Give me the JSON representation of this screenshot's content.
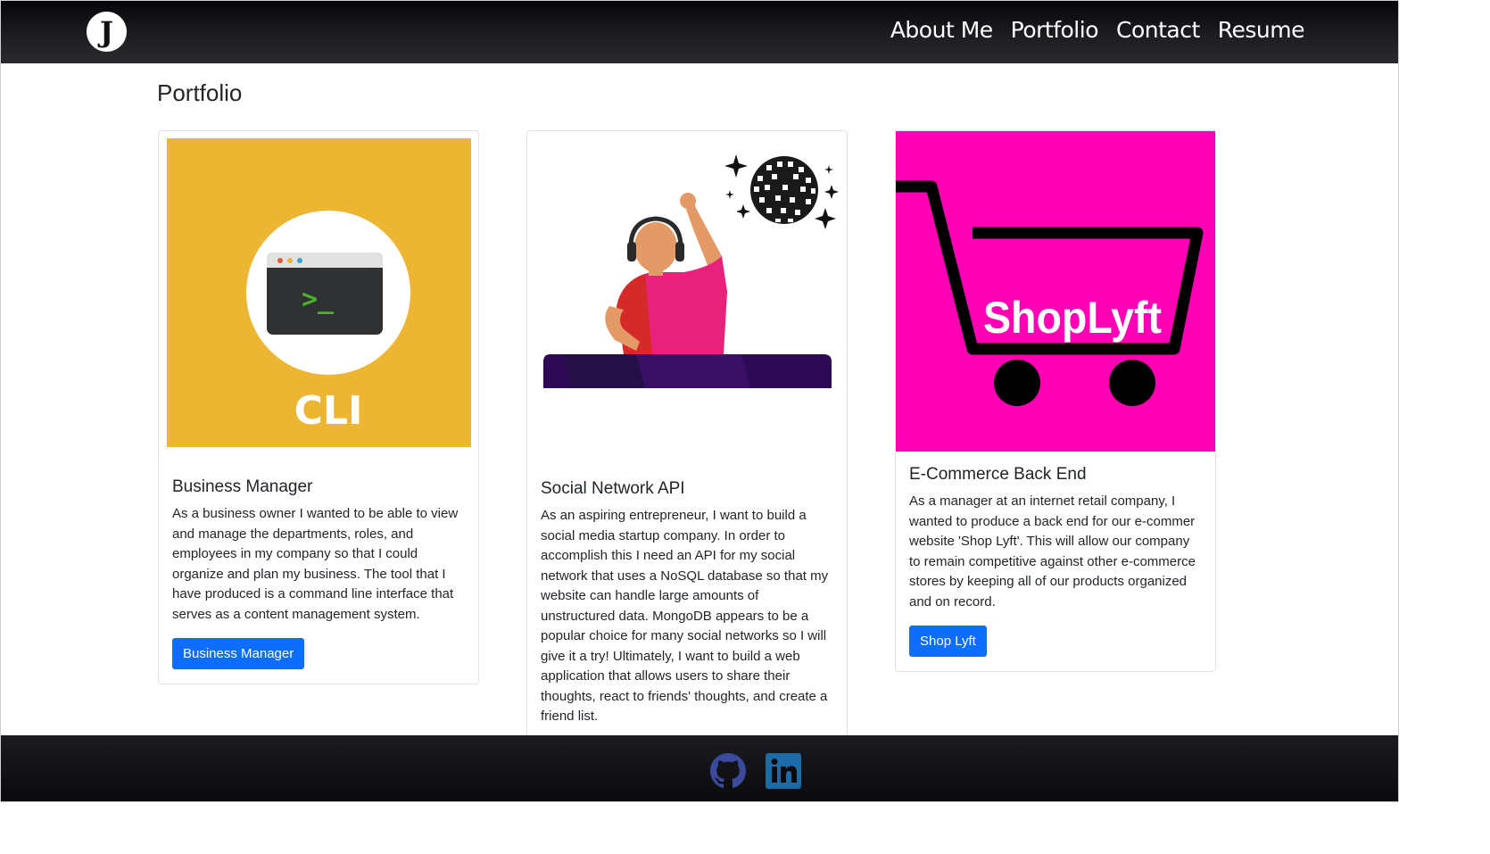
{
  "header": {
    "logo_icon": "j-monogram-logo",
    "nav": [
      "About Me",
      "Portfolio",
      "Contact",
      "Resume"
    ]
  },
  "main": {
    "page_title": "Portfolio",
    "cards": [
      {
        "title": "Business Manager",
        "image_label": "CLI",
        "text": "As a business owner I wanted to be able to view and manage the departments, roles, and employees in my company so that I could organize and plan my business. The tool that I have produced is a command line interface that serves as a content management system.",
        "button": "Business Manager"
      },
      {
        "title": "Social Network API",
        "image_label": "",
        "text": "As an aspiring entrepreneur, I want to build a social media startup company. In order to accomplish this I need an API for my social network that uses a NoSQL database so that my website can handle large amounts of unstructured data. MongoDB appears to be a popular choice for many social networks so I will give it a try! Ultimately, I want to build a web application that allows users to share their thoughts, react to friends' thoughts, and create a friend list.",
        "button": ""
      },
      {
        "title": "E-Commerce Back End",
        "image_label": "ShopLyft",
        "text": "As a manager at an internet retail company, I wanted to produce a back end for our e-commer website 'Shop Lyft'. This will allow our company to remain competitive against other e-commerce stores by keeping all of our products organized and on record.",
        "button": "Shop Lyft"
      }
    ]
  },
  "footer": {
    "icons": [
      "github-icon",
      "linkedin-icon"
    ]
  },
  "colors": {
    "accent": "#0d6efd",
    "cli_bg": "#ecb633",
    "shoplyft_bg": "#ff00b4",
    "navbar": "#1c1d22"
  }
}
